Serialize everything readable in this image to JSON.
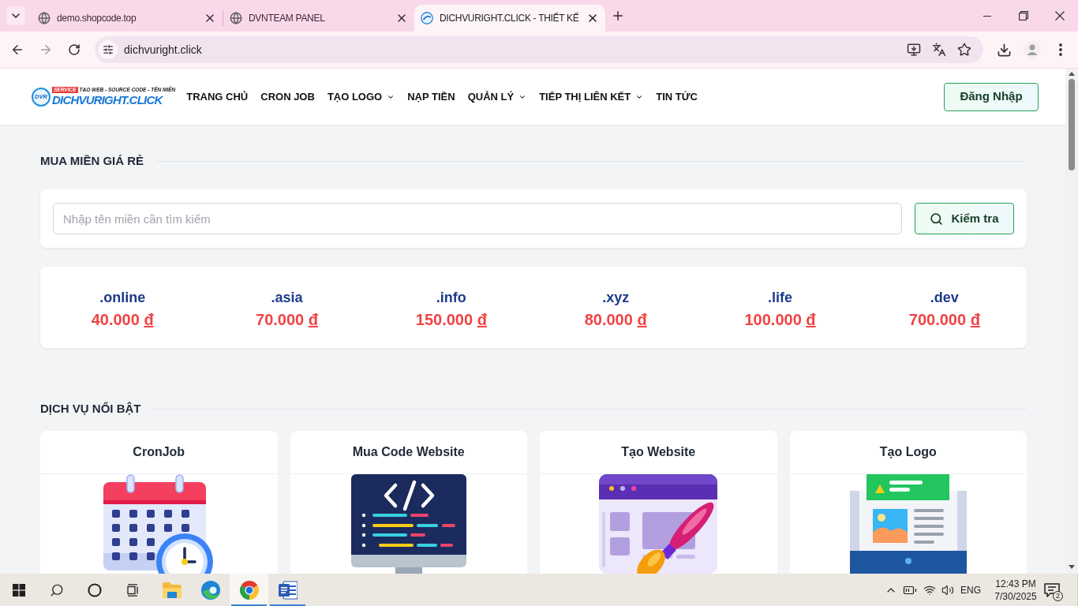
{
  "browser": {
    "tabs": [
      {
        "title": "demo.shopcode.top",
        "kind": "globe",
        "selected": false
      },
      {
        "title": "DVNTEAM PANEL",
        "kind": "globe",
        "selected": false
      },
      {
        "title": "DICHVURIGHT.CLICK - THIẾT KẾ",
        "kind": "logo",
        "selected": true
      }
    ],
    "address": "dichvuright.click"
  },
  "header": {
    "logo": {
      "mark": "DVR",
      "badge": "SERVICE",
      "tagline": "TẠO WEB - SOURCE CODE - TÊN MIỀN",
      "name": "DICHVURIGHT.CLICK"
    },
    "nav": [
      {
        "label": "TRANG CHỦ",
        "dropdown": false
      },
      {
        "label": "CRON JOB",
        "dropdown": false
      },
      {
        "label": "TẠO LOGO",
        "dropdown": true
      },
      {
        "label": "NẠP TIỀN",
        "dropdown": false
      },
      {
        "label": "QUẢN LÝ",
        "dropdown": true
      },
      {
        "label": "TIẾP THỊ LIÊN KẾT",
        "dropdown": true
      },
      {
        "label": "TIN TỨC",
        "dropdown": false
      }
    ],
    "login_button": "Đăng Nhập"
  },
  "domain_section": {
    "title": "MUA MIỀN GIÁ RẺ",
    "search": {
      "placeholder": "Nhập tên miền cần tìm kiếm",
      "button": "Kiểm tra"
    },
    "prices": [
      {
        "tld": ".online",
        "price": "40.000",
        "currency": "đ"
      },
      {
        "tld": ".asia",
        "price": "70.000",
        "currency": "đ"
      },
      {
        "tld": ".info",
        "price": "150.000",
        "currency": "đ"
      },
      {
        "tld": ".xyz",
        "price": "80.000",
        "currency": "đ"
      },
      {
        "tld": ".life",
        "price": "100.000",
        "currency": "đ"
      },
      {
        "tld": ".dev",
        "price": "700.000",
        "currency": "đ"
      }
    ]
  },
  "services_section": {
    "title": "DỊCH VỤ NỔI BẬT",
    "cards": [
      {
        "title": "CronJob",
        "kind": "calendar"
      },
      {
        "title": "Mua Code Website",
        "kind": "code"
      },
      {
        "title": "Tạo Website",
        "kind": "web"
      },
      {
        "title": "Tạo Logo",
        "kind": "logo"
      }
    ]
  },
  "taskbar": {
    "apps": [
      {
        "kind": "explorer",
        "running": false,
        "selected": false
      },
      {
        "kind": "edge",
        "running": false,
        "selected": false
      },
      {
        "kind": "chrome",
        "running": true,
        "selected": true
      },
      {
        "kind": "word",
        "running": true,
        "selected": false
      }
    ],
    "language": "ENG",
    "time": "12:43 PM",
    "date": "7/30/2025",
    "notifications": "2"
  }
}
